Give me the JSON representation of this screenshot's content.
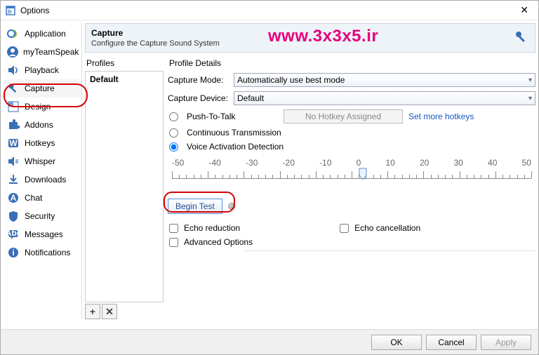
{
  "window": {
    "title": "Options"
  },
  "watermark": "www.3x3x5.ir",
  "sidebar": {
    "items": [
      {
        "label": "Application",
        "icon": "app"
      },
      {
        "label": "myTeamSpeak",
        "icon": "ts"
      },
      {
        "label": "Playback",
        "icon": "speaker"
      },
      {
        "label": "Capture",
        "icon": "mic",
        "selected": true
      },
      {
        "label": "Design",
        "icon": "design"
      },
      {
        "label": "Addons",
        "icon": "puzzle"
      },
      {
        "label": "Hotkeys",
        "icon": "keyw"
      },
      {
        "label": "Whisper",
        "icon": "whisper"
      },
      {
        "label": "Downloads",
        "icon": "download"
      },
      {
        "label": "Chat",
        "icon": "chat"
      },
      {
        "label": "Security",
        "icon": "shield"
      },
      {
        "label": "Messages",
        "icon": "msg"
      },
      {
        "label": "Notifications",
        "icon": "info"
      }
    ]
  },
  "header": {
    "title": "Capture",
    "subtitle": "Configure the Capture Sound System"
  },
  "profiles": {
    "heading": "Profiles",
    "items": [
      "Default"
    ],
    "add": "+",
    "del": "✕"
  },
  "details": {
    "heading": "Profile Details",
    "mode_label": "Capture Mode:",
    "mode_value": "Automatically use best mode",
    "device_label": "Capture Device:",
    "device_value": "Default",
    "ptt": "Push-To-Talk",
    "hotkey_none": "No Hotkey Assigned",
    "more_hotkeys": "Set more hotkeys",
    "continuous": "Continuous Transmission",
    "vad": "Voice Activation Detection",
    "slider_ticks": [
      "-50",
      "-40",
      "-30",
      "-20",
      "-10",
      "0",
      "10",
      "20",
      "30",
      "40",
      "50"
    ],
    "slider_value": 2,
    "begin": "Begin Test",
    "echo_red": "Echo reduction",
    "echo_can": "Echo cancellation",
    "advanced": "Advanced Options"
  },
  "footer": {
    "ok": "OK",
    "cancel": "Cancel",
    "apply": "Apply"
  }
}
